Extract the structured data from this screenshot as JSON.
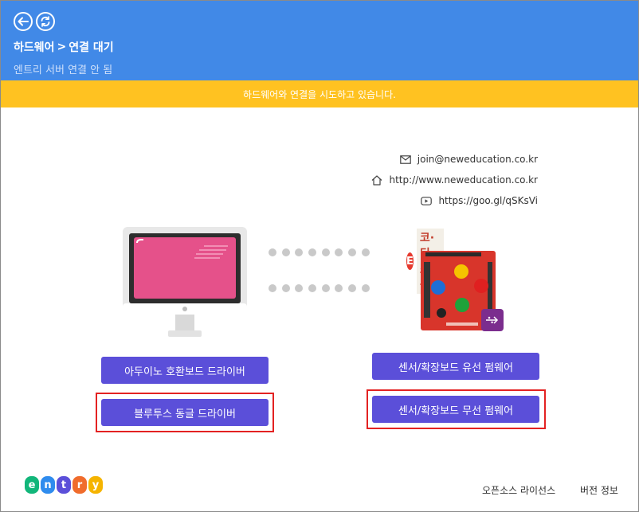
{
  "header": {
    "breadcrumb_part1": "하드웨어",
    "breadcrumb_separator": ">",
    "breadcrumb_part2": "연결 대기",
    "subtitle": "엔트리 서버 연결 안 됨"
  },
  "banner": {
    "message": "하드웨어와 연결을 시도하고 있습니다."
  },
  "contacts": {
    "email": "join@neweducation.co.kr",
    "website": "http://www.neweducation.co.kr",
    "youtube": "https://goo.gl/qSKsVi"
  },
  "device": {
    "brand_initial": "E",
    "brand_name": "코·딩·스·쿨",
    "icons": [
      "monitor-icon",
      "connection-dots",
      "arduino-board-image",
      "usb-icon"
    ]
  },
  "buttons": {
    "arduino_driver": "아두이노 호환보드 드라이버",
    "bluetooth_dongle_driver": "블루투스 동글 드라이버",
    "wired_firmware": "센서/확장보드 유선 펌웨어",
    "wireless_firmware": "센서/확장보드 무선 펌웨어"
  },
  "footer": {
    "logo_letters": [
      "e",
      "n",
      "t",
      "r",
      "y"
    ],
    "open_source_license": "오픈소스 라이선스",
    "version_info": "버전 정보"
  },
  "colors": {
    "header_bg": "#4189e7",
    "banner_bg": "#ffc221",
    "button_bg": "#5b4fd9",
    "highlight_border": "#e32222"
  }
}
